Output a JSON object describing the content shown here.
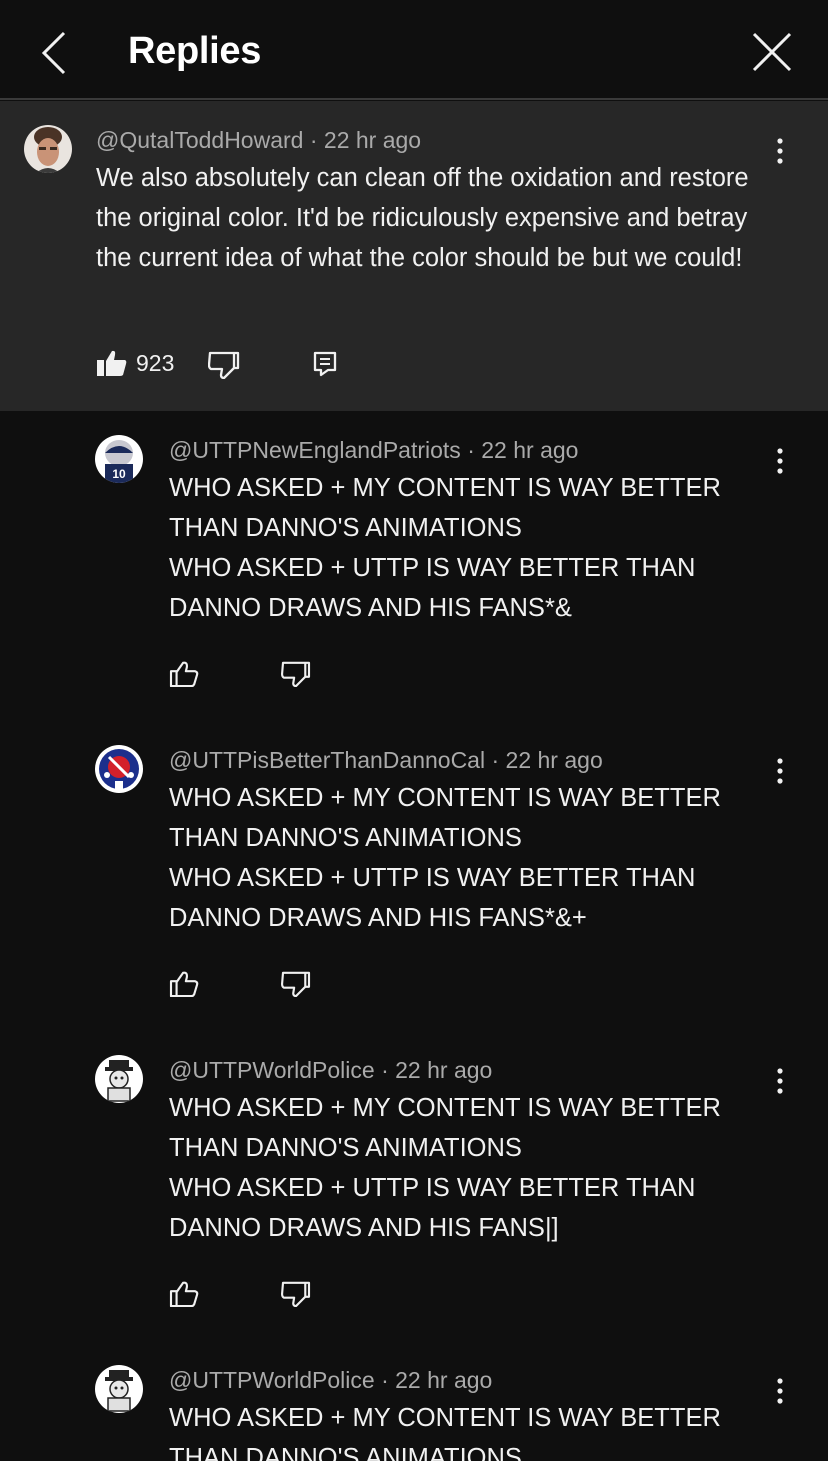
{
  "header": {
    "title": "Replies"
  },
  "main_comment": {
    "author": "@QutalToddHoward",
    "time": "22 hr ago",
    "text": "We also absolutely can clean off the oxidation and restore the original color. It'd be ridiculously expensive and betray the current idea of what the color should be but we could!",
    "likes": "923"
  },
  "replies": [
    {
      "author": "@UTTPNewEnglandPatriots",
      "time": "22 hr ago",
      "lines": [
        "WHO ASKED + MY CONTENT IS WAY BETTER",
        "THAN DANNO'S ANIMATIONS",
        "WHO ASKED + UTTP IS WAY BETTER THAN",
        "DANNO DRAWS AND HIS FANS*&"
      ]
    },
    {
      "author": "@UTTPisBetterThanDannoCal",
      "time": "22 hr ago",
      "lines": [
        "WHO ASKED + MY CONTENT IS WAY BETTER",
        "THAN DANNO'S ANIMATIONS",
        "WHO ASKED + UTTP IS WAY BETTER THAN",
        "DANNO DRAWS AND HIS FANS*&+"
      ]
    },
    {
      "author": "@UTTPWorldPolice",
      "time": "22 hr ago",
      "lines": [
        "WHO ASKED + MY CONTENT IS WAY BETTER",
        "THAN DANNO'S ANIMATIONS",
        "WHO ASKED + UTTP IS WAY BETTER THAN",
        "DANNO DRAWS AND HIS FANS|]"
      ]
    },
    {
      "author": "@UTTPWorldPolice",
      "time": "22 hr ago",
      "lines": [
        "WHO ASKED + MY CONTENT IS WAY BETTER",
        "THAN DANNO'S ANIMATIONS"
      ]
    }
  ],
  "colors": {
    "background": "#0f0f0f",
    "highlight": "#272727",
    "meta": "#aaaaaa"
  },
  "icons": [
    "chevron-left-icon",
    "close-icon",
    "more-vert-icon",
    "thumb-up-icon",
    "thumb-down-icon",
    "comment-icon"
  ]
}
